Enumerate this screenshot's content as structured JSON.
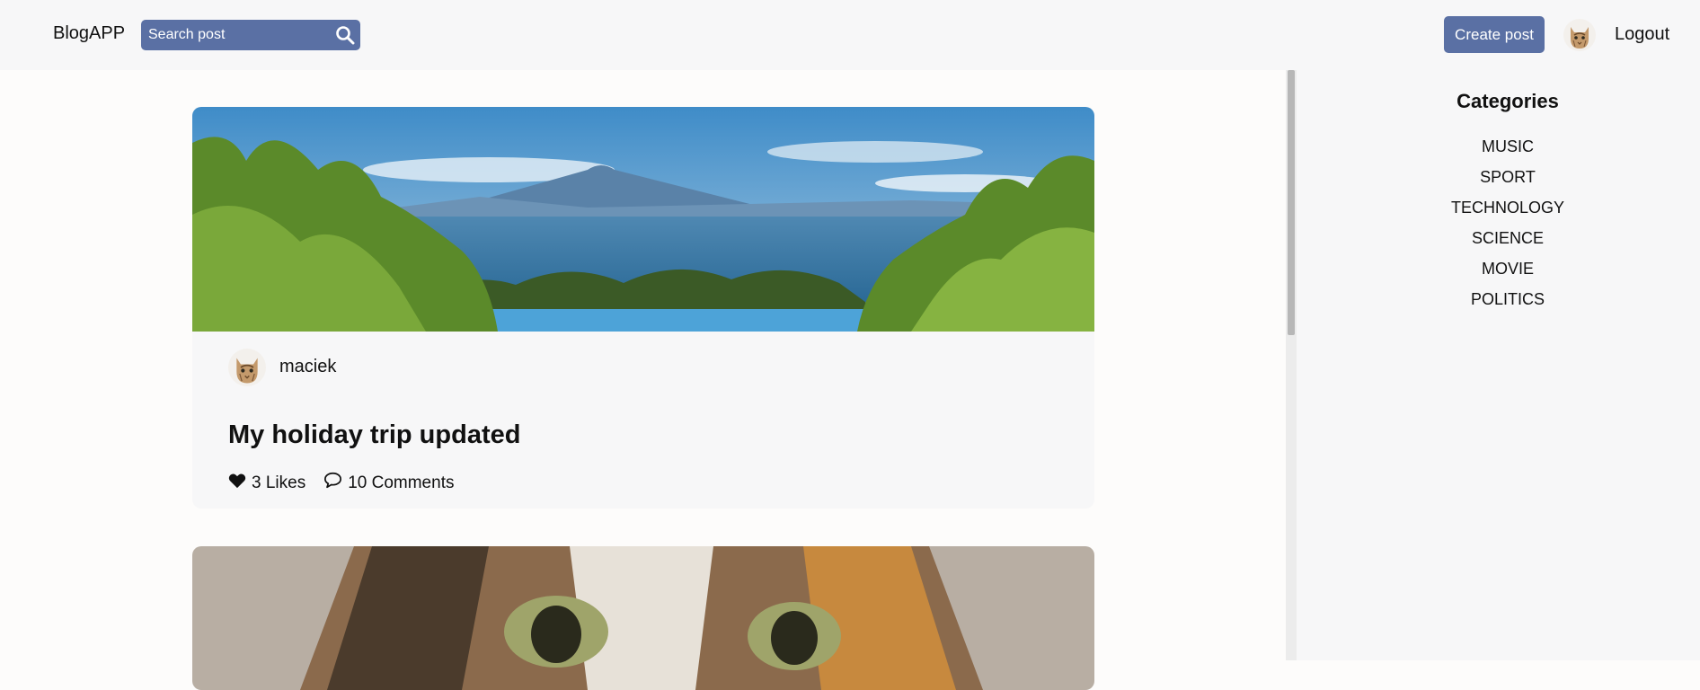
{
  "header": {
    "brand": "BlogAPP",
    "search_placeholder": "Search post",
    "create_post_label": "Create post",
    "logout_label": "Logout"
  },
  "sidebar": {
    "title": "Categories",
    "categories": [
      "MUSIC",
      "SPORT",
      "TECHNOLOGY",
      "SCIENCE",
      "MOVIE",
      "POLITICS"
    ]
  },
  "posts": [
    {
      "author": "maciek",
      "title": "My holiday trip updated",
      "likes_label": "3 Likes",
      "comments_label": "10 Comments"
    }
  ],
  "colors": {
    "accent": "#5a70a4",
    "topbar_bg": "#f7f7f8",
    "page_bg": "#fdfcfb"
  }
}
